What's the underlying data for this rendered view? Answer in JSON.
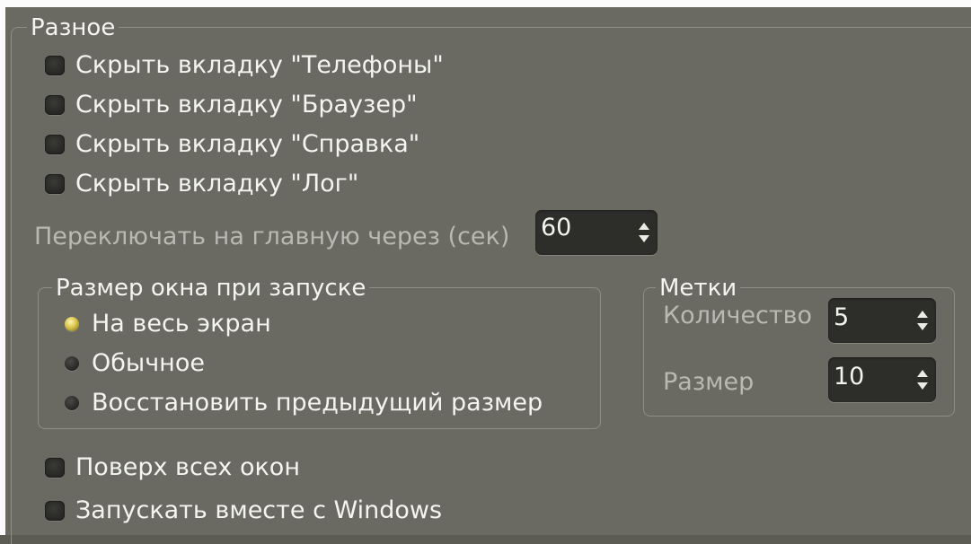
{
  "misc_group": {
    "title": "Разное",
    "checkboxes": [
      {
        "label": "Скрыть вкладку \"Телефоны\"",
        "checked": false
      },
      {
        "label": "Скрыть вкладку \"Браузер\"",
        "checked": false
      },
      {
        "label": "Скрыть вкладку \"Справка\"",
        "checked": false
      },
      {
        "label": "Скрыть вкладку \"Лог\"",
        "checked": false
      }
    ],
    "switch_label": "Переключать на главную через (сек)",
    "switch_value": "60"
  },
  "window_size_group": {
    "title": "Размер окна при запуске",
    "options": [
      {
        "label": "На весь экран",
        "selected": true
      },
      {
        "label": "Обычное",
        "selected": false
      },
      {
        "label": "Восстановить предыдущий размер",
        "selected": false
      }
    ]
  },
  "marks_group": {
    "title": "Метки",
    "count_label": "Количество",
    "count_value": "5",
    "size_label": "Размер",
    "size_value": "10"
  },
  "bottom_checkboxes": [
    {
      "label": "Поверх всех окон",
      "checked": false
    },
    {
      "label": "Запускать вместе с Windows",
      "checked": false
    }
  ],
  "colors": {
    "background": "#6a6a62",
    "accent_radio": "#d9c44c",
    "text": "#f4f4f0",
    "dim_text": "#b9b9b2"
  }
}
